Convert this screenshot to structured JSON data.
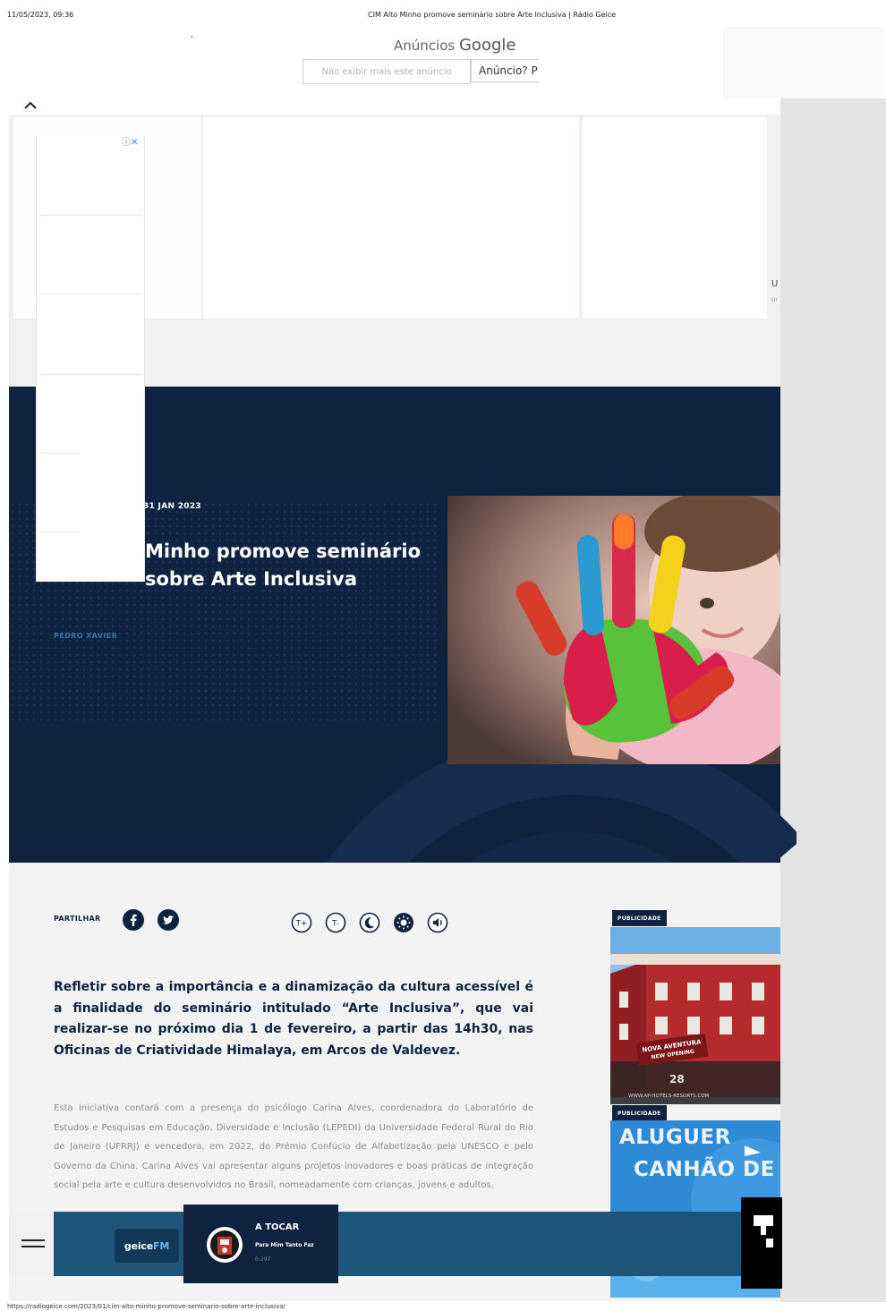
{
  "print": {
    "date": "11/05/2023, 09:36",
    "title": "CIM Alto Minho promove seminário sobre Arte Inclusiva | Rádio Geice",
    "url": "https://radiogeice.com/2023/01/cim-alto-minho-promove-seminario-sobre-arte-inclusiva/"
  },
  "ad": {
    "label_prefix": "Anúncios",
    "label_brand": "Google",
    "dismiss": "Não exibir mais este anúncio",
    "why": "Anúncio? P",
    "side_text_1": "U",
    "side_text_2": "Ur"
  },
  "article": {
    "date": "31 JAN 2023",
    "title_visible": "Minho promove seminário sobre Arte Inclusiva",
    "author": "PEDRO XAVIER",
    "share_label": "PARTILHAR",
    "lead": "Refletir sobre a importância e a dinamização da cultura acessível é a finalidade do seminário intitulado “Arte Inclusiva”, que vai realizar-se no próximo dia 1 de fevereiro, a partir das 14h30, nas Oficinas de Criatividade Himalaya, em Arcos de Valdevez.",
    "body": "Esta iniciativa contará com a presença do psicólogo Carina Alves, coordenadora do Laboratório de Estudos e Pesquisas em Educação, Diversidade e Inclusão (LEPEDI) da Universidade Federal Rural do Rio de Janeiro (UFRRJ) e vencedora, em 2022, do Prémio Confúcio de Alfabetização pela UNESCO e pelo Governo da China. Carina Alves vai apresentar alguns projetos inovadores e boas práticas de integração social pela arte e cultura desenvolvidos no Brasil, nomeadamente com crianças, jovens e adultos,"
  },
  "tools": {
    "increase": "T+",
    "decrease": "T-"
  },
  "sidebar": {
    "pub_label_1": "PUBLICIDADE",
    "pub_label_2": "PUBLICIDADE",
    "hotel_banner": "NOVA AVENTURA\nNEW OPENING",
    "hotel_date": "28",
    "hotel_url": "WWW.AP-HOTELS-RESORTS.COM",
    "aluguer_1": "ALUGUER",
    "aluguer_2": "CANHÃO DE N"
  },
  "player": {
    "logo_a": "geice",
    "logo_b": "FM",
    "now_label": "A TOCAR",
    "track": "Para Mim Tanto Faz",
    "time": "0:297"
  },
  "colors": {
    "navy": "#0f2341",
    "player": "#1d5578",
    "facebook": "#1877f2"
  }
}
